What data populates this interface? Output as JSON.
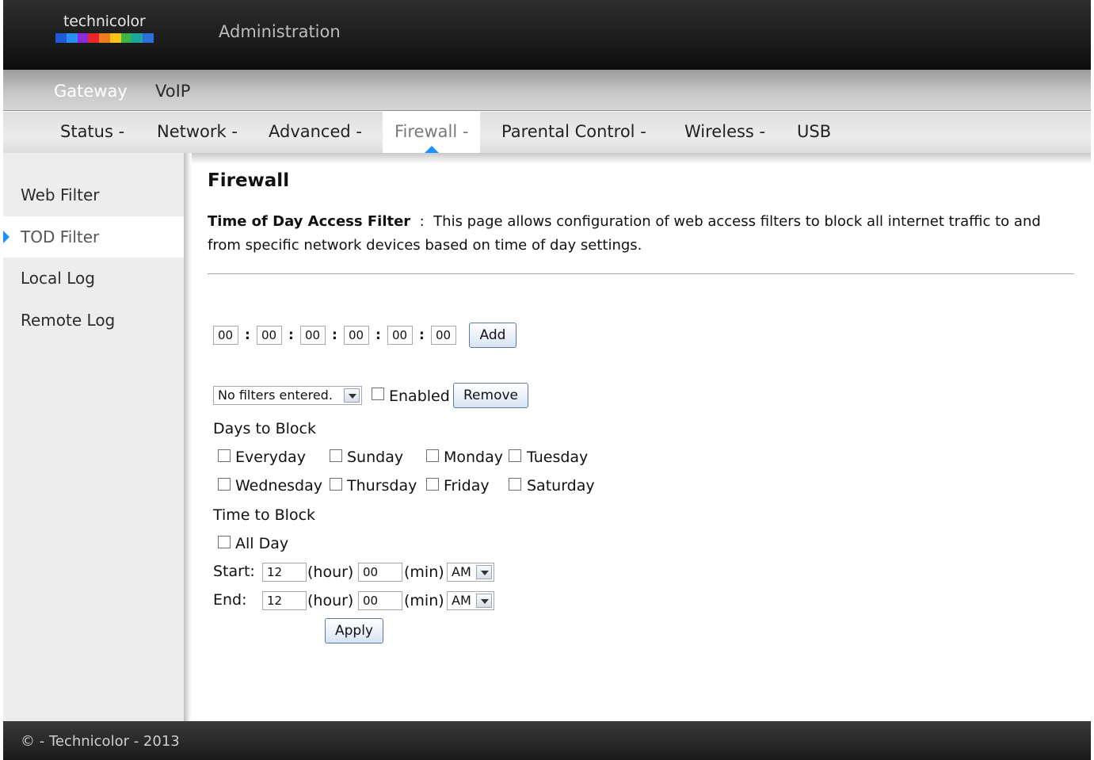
{
  "header": {
    "logo_text": "technicolor",
    "logo_colors": [
      "#1e5bd8",
      "#2b8ef0",
      "#8a2be2",
      "#e8262a",
      "#f37a1f",
      "#f5c518",
      "#3cb44b",
      "#1aa7a0",
      "#2a6fdb"
    ],
    "app_title": "Administration"
  },
  "main_nav": {
    "items": [
      {
        "label": "Gateway",
        "active": true
      },
      {
        "label": "VoIP",
        "active": false
      }
    ]
  },
  "sub_nav": {
    "tabs": [
      {
        "label": "Status -"
      },
      {
        "label": "Network -"
      },
      {
        "label": "Advanced -"
      },
      {
        "label": "Firewall -",
        "active": true
      },
      {
        "label": "Parental Control -"
      },
      {
        "label": "Wireless -"
      },
      {
        "label": "USB"
      }
    ],
    "accent_color": "#1e90ff"
  },
  "sidebar": {
    "items": [
      {
        "label": "Web Filter"
      },
      {
        "label": "TOD Filter",
        "active": true
      },
      {
        "label": "Local Log"
      },
      {
        "label": "Remote Log"
      }
    ]
  },
  "content": {
    "title": "Firewall",
    "desc_label": "Time of Day Access Filter",
    "desc_sep": ":",
    "desc_text": "This page allows configuration of web access filters to block all internet traffic to and from specific network devices based on time of day settings.",
    "mac_fields": [
      "00",
      "00",
      "00",
      "00",
      "00",
      "00"
    ],
    "mac_separator": ":",
    "add_button": "Add",
    "filter_select": "No filters entered.",
    "enabled_label": "Enabled",
    "remove_button": "Remove",
    "days_heading": "Days to Block",
    "days": [
      "Everyday",
      "Sunday",
      "Monday",
      "Tuesday",
      "Wednesday",
      "Thursday",
      "Friday",
      "Saturday"
    ],
    "time_heading": "Time to Block",
    "all_day_label": "All Day",
    "start_label": "Start:",
    "end_label": "End:",
    "start_hour": "12",
    "start_min": "00",
    "start_ampm": "AM",
    "end_hour": "12",
    "end_min": "00",
    "end_ampm": "AM",
    "hour_unit": "(hour)",
    "min_unit": "(min)",
    "apply_button": "Apply"
  },
  "footer": {
    "text": "© - Technicolor - 2013"
  }
}
